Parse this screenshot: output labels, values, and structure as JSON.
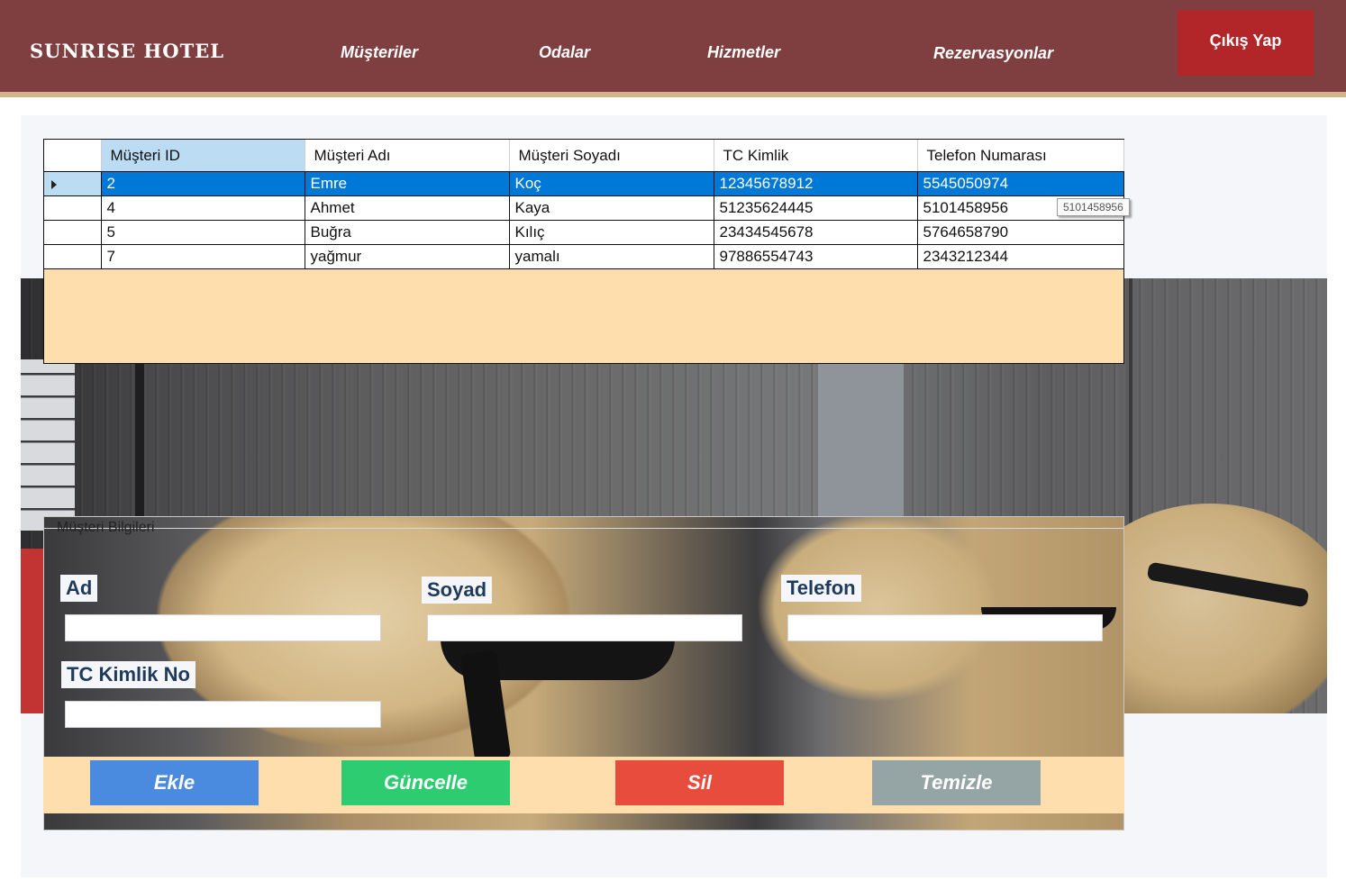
{
  "header": {
    "brand": "SUNRISE HOTEL",
    "nav": [
      "Müşteriler",
      "Odalar",
      "Hizmetler",
      "Rezervasyonlar"
    ],
    "logout_label": "Çıkış Yap"
  },
  "grid": {
    "columns": [
      "Müşteri ID",
      "Müşteri Adı",
      "Müşteri Soyadı",
      "TC Kimlik",
      "Telefon Numarası"
    ],
    "rows": [
      [
        "2",
        "Emre",
        "Koç",
        "12345678912",
        "5545050974"
      ],
      [
        "4",
        "Ahmet",
        "Kaya",
        "51235624445",
        "5101458956"
      ],
      [
        "5",
        "Buğra",
        "Kılıç",
        "23434545678",
        "5764658790"
      ],
      [
        "7",
        "yağmur",
        "yamalı",
        "97886554743",
        "2343212344"
      ]
    ],
    "selected_row": 0,
    "tooltip": "5101458956"
  },
  "form": {
    "legend": "Müşteri Bilgileri",
    "ad_label": "Ad",
    "soyad_label": "Soyad",
    "telefon_label": "Telefon",
    "tc_label": "TC Kimlik No",
    "ad_value": "",
    "soyad_value": "",
    "telefon_value": "",
    "tc_value": ""
  },
  "buttons": {
    "add": "Ekle",
    "update": "Güncelle",
    "delete": "Sil",
    "clear": "Temizle"
  },
  "colors": {
    "header_bg": "#7f3e3f",
    "logout_bg": "#b22528",
    "grid_bg": "#fddeac",
    "selection": "#0078d7",
    "add_btn": "#4a8be0",
    "update_btn": "#2ecc71",
    "delete_btn": "#e74c3c",
    "clear_btn": "#95a5a6"
  }
}
